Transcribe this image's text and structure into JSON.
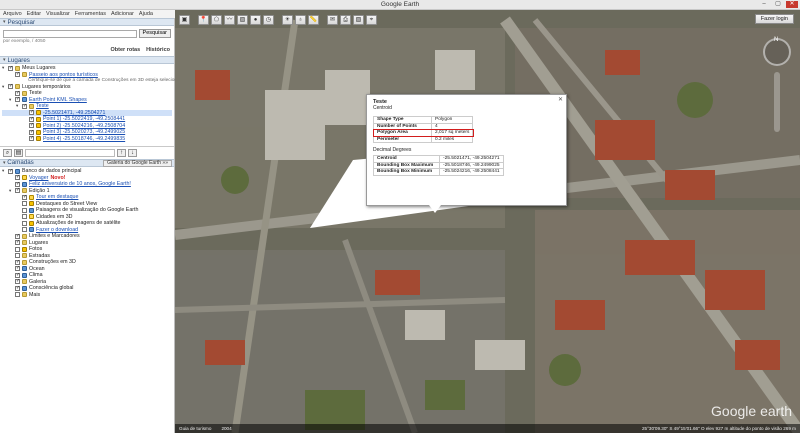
{
  "window": {
    "title": "Google Earth",
    "menu": [
      "Arquivo",
      "Editar",
      "Visualizar",
      "Ferramentas",
      "Adicionar",
      "Ajuda"
    ]
  },
  "search": {
    "header": "Pesquisar",
    "button": "Pesquisar",
    "hint": "por exemplo, / 4050",
    "links": [
      "Obter rotas",
      "Histórico"
    ]
  },
  "places": {
    "header": "Lugares",
    "items": [
      {
        "label": "Meus Lugares",
        "indent": 0,
        "checked": true,
        "icon": "folder",
        "expand": "▾"
      },
      {
        "label": "Passeio aos pontos turísticos",
        "indent": 1,
        "checked": true,
        "icon": "folder",
        "link": true
      },
      {
        "label": "Certifique-se de que a camada de Construções em 3D esteja selecionada",
        "indent": 2,
        "sub": true
      },
      {
        "label": "Lugares temporários",
        "indent": 0,
        "checked": true,
        "icon": "folder",
        "expand": "▾"
      },
      {
        "label": "Teste",
        "indent": 1,
        "checked": true,
        "icon": "folder"
      },
      {
        "label": "Earth Point KML Shapes",
        "indent": 1,
        "checked": true,
        "icon": "globe",
        "link": true,
        "expand": "▾"
      },
      {
        "label": "Teste",
        "indent": 2,
        "checked": true,
        "icon": "folder",
        "link": true,
        "expand": "▾"
      },
      {
        "label": "-25.5021471, -49.2504271",
        "indent": 3,
        "checked": true,
        "icon": "pin",
        "link": true,
        "selected": true
      },
      {
        "label": "Point 1) -25.5022419, -49.2508441",
        "indent": 3,
        "checked": true,
        "icon": "pin",
        "link": true
      },
      {
        "label": "Point 2) -25.5024216, -49.2508704",
        "indent": 3,
        "checked": true,
        "icon": "pin",
        "link": true
      },
      {
        "label": "Point 3) -25.5020273, -49.2499025",
        "indent": 3,
        "checked": true,
        "icon": "pin",
        "link": true
      },
      {
        "label": "Point 4) -25.5018746, -49.2499835",
        "indent": 3,
        "checked": true,
        "icon": "pin",
        "link": true
      }
    ]
  },
  "layers": {
    "header": "Camadas",
    "gallery_button": "Galeria do Google Earth »»",
    "items": [
      {
        "label": "Banco de dados principal",
        "indent": 0,
        "checked": true,
        "icon": "globe",
        "expand": "▾"
      },
      {
        "label": "Voyager",
        "extra": "Novo!",
        "indent": 1,
        "checked": true,
        "icon": "star",
        "link": true
      },
      {
        "label": "Feliz aniversário de 10 anos, Google Earth!",
        "indent": 1,
        "checked": true,
        "icon": "globe",
        "link": true
      },
      {
        "label": "Edição 1",
        "indent": 1,
        "checked": true,
        "icon": "folder",
        "expand": "▾"
      },
      {
        "label": "Tour em destaque",
        "indent": 2,
        "checked": true,
        "icon": "star",
        "link": true
      },
      {
        "label": "Destaques do Street View",
        "indent": 2,
        "checked": false,
        "icon": "pin"
      },
      {
        "label": "Paisagens de visualização do Google Earth",
        "indent": 2,
        "checked": false,
        "icon": "globe"
      },
      {
        "label": "Cidades em 3D",
        "indent": 2,
        "checked": false,
        "icon": "star"
      },
      {
        "label": "Atualizações de imagens de satélite",
        "indent": 2,
        "checked": false,
        "icon": "pin"
      },
      {
        "label": "Fazer o download",
        "indent": 2,
        "checked": false,
        "icon": "globe",
        "link": true
      },
      {
        "label": "Limites e Marcadores",
        "indent": 1,
        "checked": true,
        "icon": "folder"
      },
      {
        "label": "Lugares",
        "indent": 1,
        "checked": true,
        "icon": "folder"
      },
      {
        "label": "Fotos",
        "indent": 1,
        "checked": false,
        "icon": "pin"
      },
      {
        "label": "Estradas",
        "indent": 1,
        "checked": false,
        "icon": "folder"
      },
      {
        "label": "Construções em 3D",
        "indent": 1,
        "checked": true,
        "icon": "folder"
      },
      {
        "label": "Ocean",
        "indent": 1,
        "checked": true,
        "icon": "globe"
      },
      {
        "label": "Clima",
        "indent": 1,
        "checked": true,
        "icon": "globe"
      },
      {
        "label": "Galeria",
        "indent": 1,
        "checked": true,
        "icon": "folder"
      },
      {
        "label": "Consciência global",
        "indent": 1,
        "checked": true,
        "icon": "globe"
      },
      {
        "label": "Mais",
        "indent": 1,
        "checked": false,
        "icon": "folder"
      }
    ]
  },
  "toolbar": {
    "login": "Fazer login",
    "icons": [
      "sidebar-icon",
      "placemark-icon",
      "polygon-icon",
      "path-icon",
      "overlay-icon",
      "record-tour-icon",
      "history-icon",
      "sun-icon",
      "planets-icon",
      "ruler-icon",
      "email-icon",
      "print-icon",
      "save-image-icon",
      "maps-icon"
    ]
  },
  "balloon": {
    "title": "Teste",
    "subtitle": "Centroid",
    "props": [
      {
        "k": "Shape Type",
        "v": "Polygon"
      },
      {
        "k": "Number of Points",
        "v": "4"
      },
      {
        "k": "Polygon Area",
        "v": "2,017 sq meters",
        "highlight": true
      },
      {
        "k": "Perimeter",
        "v": "0.2 miles"
      }
    ],
    "section": "Decimal Degrees",
    "coords": [
      {
        "k": "Centroid",
        "v": "-25.5021471, -49.2504271"
      },
      {
        "k": "Bounding Box Maximum",
        "v": "-25.5018746, -49.2499025"
      },
      {
        "k": "Bounding Box Minimum",
        "v": "-25.5024216, -49.2508441"
      }
    ]
  },
  "status": {
    "tour_guide": "Guia de turismo",
    "year": "2004",
    "coords": "25°30'09.30\" S 49°15'01.66\" O  elev 927 m  altitude do ponto de visão 269 m",
    "logo": "Google earth"
  }
}
